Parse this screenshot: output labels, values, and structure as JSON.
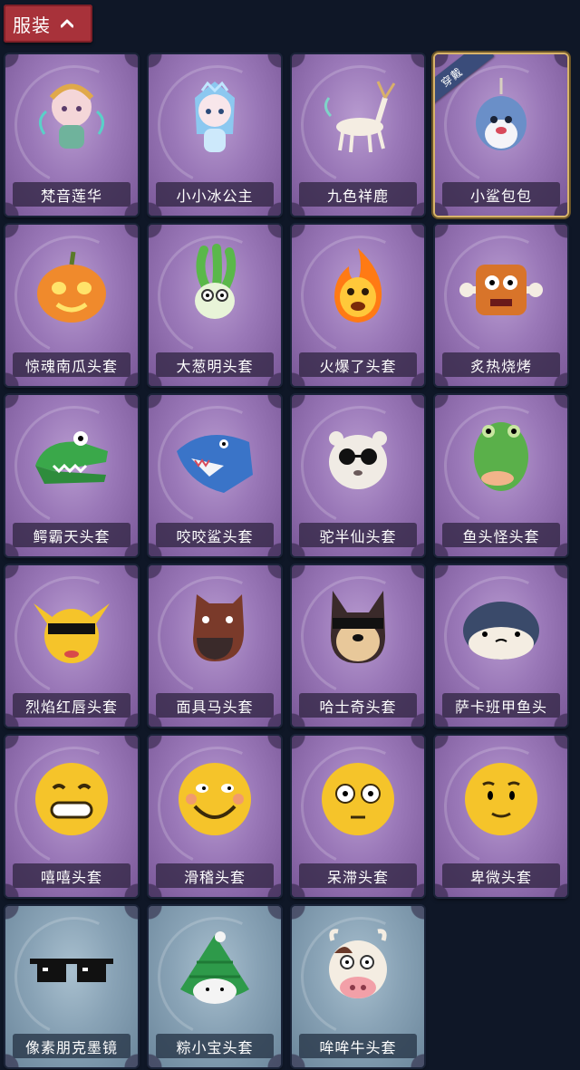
{
  "section": {
    "title": "服装"
  },
  "worn_badge": "穿戴",
  "items": [
    {
      "name": "梵音莲华",
      "icon": "lotus-fairy-character-icon",
      "theme": "purple"
    },
    {
      "name": "小小冰公主",
      "icon": "ice-princess-character-icon",
      "theme": "purple"
    },
    {
      "name": "九色祥鹿",
      "icon": "nine-color-deer-icon",
      "theme": "purple"
    },
    {
      "name": "小鲨包包",
      "icon": "little-shark-bag-icon",
      "theme": "purple",
      "selected": true
    },
    {
      "name": "惊魂南瓜头套",
      "icon": "pumpkin-head-icon",
      "theme": "purple"
    },
    {
      "name": "大葱明头套",
      "icon": "green-onion-head-icon",
      "theme": "purple"
    },
    {
      "name": "火爆了头套",
      "icon": "fire-head-icon",
      "theme": "purple"
    },
    {
      "name": "炙热烧烤",
      "icon": "bbq-meat-head-icon",
      "theme": "purple"
    },
    {
      "name": "鳄霸天头套",
      "icon": "crocodile-head-icon",
      "theme": "purple"
    },
    {
      "name": "咬咬鲨头套",
      "icon": "shark-head-icon",
      "theme": "purple"
    },
    {
      "name": "驼半仙头套",
      "icon": "alpaca-sunglasses-head-icon",
      "theme": "purple"
    },
    {
      "name": "鱼头怪头套",
      "icon": "fish-monster-head-icon",
      "theme": "purple"
    },
    {
      "name": "烈焰红唇头套",
      "icon": "yellow-mouse-sunglasses-head-icon",
      "theme": "purple"
    },
    {
      "name": "面具马头套",
      "icon": "horse-mask-head-icon",
      "theme": "purple"
    },
    {
      "name": "哈士奇头套",
      "icon": "husky-sunglasses-head-icon",
      "theme": "purple"
    },
    {
      "name": "萨卡班甲鱼头",
      "icon": "sacabambaspis-fish-head-icon",
      "theme": "purple"
    },
    {
      "name": "嘻嘻头套",
      "icon": "grinning-emoji-head-icon",
      "theme": "purple"
    },
    {
      "name": "滑稽头套",
      "icon": "funny-smile-emoji-head-icon",
      "theme": "purple"
    },
    {
      "name": "呆滞头套",
      "icon": "dazed-emoji-head-icon",
      "theme": "purple"
    },
    {
      "name": "卑微头套",
      "icon": "humble-emoji-head-icon",
      "theme": "purple"
    },
    {
      "name": "像素朋克墨镜",
      "icon": "pixel-sunglasses-icon",
      "theme": "blue"
    },
    {
      "name": "粽小宝头套",
      "icon": "zongzi-head-icon",
      "theme": "blue"
    },
    {
      "name": "哞哞牛头套",
      "icon": "cow-head-icon",
      "theme": "blue"
    }
  ]
}
